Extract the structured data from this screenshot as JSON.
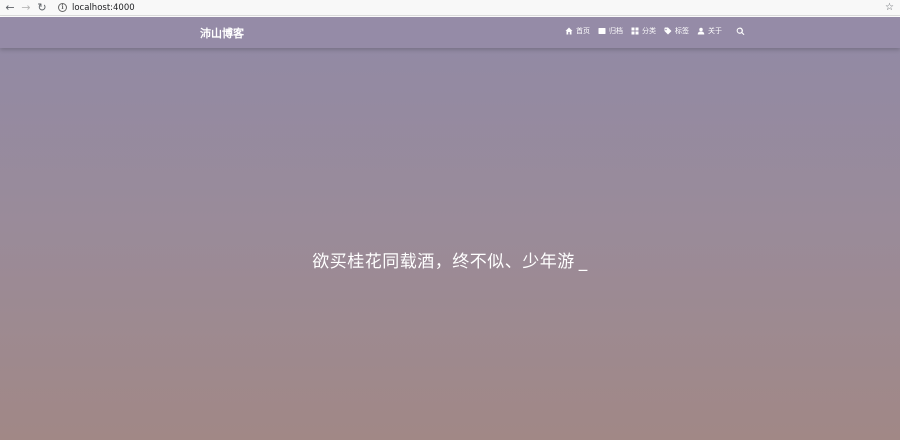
{
  "browser": {
    "url": "localhost:4000",
    "info_symbol": "i"
  },
  "site": {
    "brand": "沛山博客",
    "menu": [
      {
        "label": "首页",
        "icon": "home-icon"
      },
      {
        "label": "归档",
        "icon": "archive-icon"
      },
      {
        "label": "分类",
        "icon": "categories-icon"
      },
      {
        "label": "标签",
        "icon": "tags-icon"
      },
      {
        "label": "关于",
        "icon": "user-icon"
      }
    ],
    "search_icon": "search-icon"
  },
  "hero": {
    "text": "欲买桂花同载酒，终不似、少年游",
    "cursor": "_"
  },
  "colors": {
    "navbar": "#958ba7",
    "gradient_top": "#918aa6",
    "gradient_bottom": "#a18886",
    "text": "#ffffff"
  }
}
